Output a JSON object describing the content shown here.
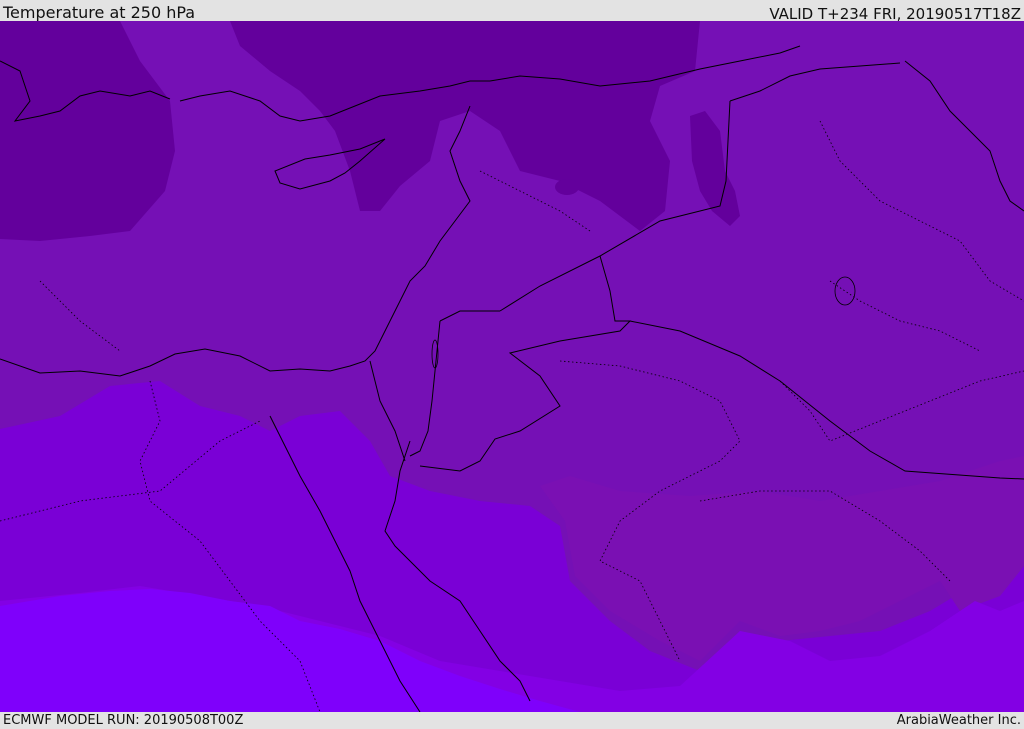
{
  "header": {
    "title": "Temperature at 250 hPa",
    "valid": "VALID T+234 FRI, 20190517T18Z"
  },
  "footer": {
    "model_run": "ECMWF MODEL RUN: 20190508T00Z",
    "credit": "ArabiaWeather Inc."
  },
  "colors": {
    "band_coldest": "#63009c",
    "band_cold": "#7510b5",
    "band_mid": "#7a00d6",
    "band_warm": "#8300e4",
    "band_warmest": "#7f00fb",
    "iraq_region": "#7a10b3",
    "coastline": "#000000"
  }
}
